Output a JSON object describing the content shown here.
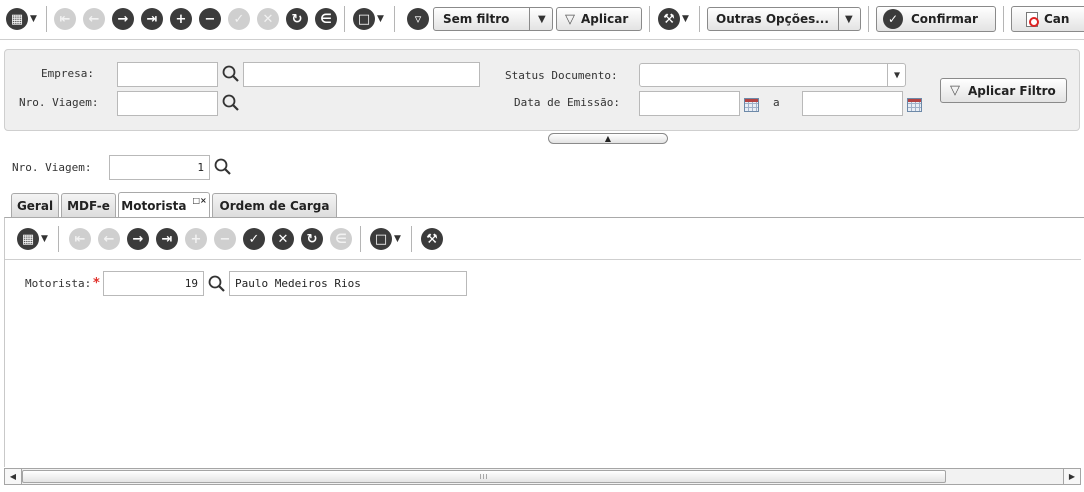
{
  "toolbar": {
    "filter_select_value": "Sem filtro",
    "apply_label": "Aplicar",
    "options_label": "Outras Opções...",
    "confirm_label": "Confirmar",
    "cancel_label": "Can"
  },
  "filter_panel": {
    "empresa_label": "Empresa:",
    "empresa_code": "",
    "empresa_name": "",
    "viagem_label": "Nro. Viagem:",
    "viagem_value": "",
    "status_label": "Status Documento:",
    "status_value": "",
    "emissao_label": "Data de Emissão:",
    "date_from": "",
    "date_sep": "a",
    "date_to": "",
    "apply_filter_label": "Aplicar Filtro"
  },
  "record": {
    "viagem_label": "Nro. Viagem:",
    "viagem_value": "1"
  },
  "tabs": [
    {
      "label": "Geral"
    },
    {
      "label": "MDF-e"
    },
    {
      "label": "Motorista"
    },
    {
      "label": "Ordem de Carga"
    }
  ],
  "motorista": {
    "label": "Motorista:",
    "required_mark": "*",
    "code": "19",
    "name": "Paulo Medeiros Rios"
  },
  "scrollbar": {
    "grip": "III"
  }
}
